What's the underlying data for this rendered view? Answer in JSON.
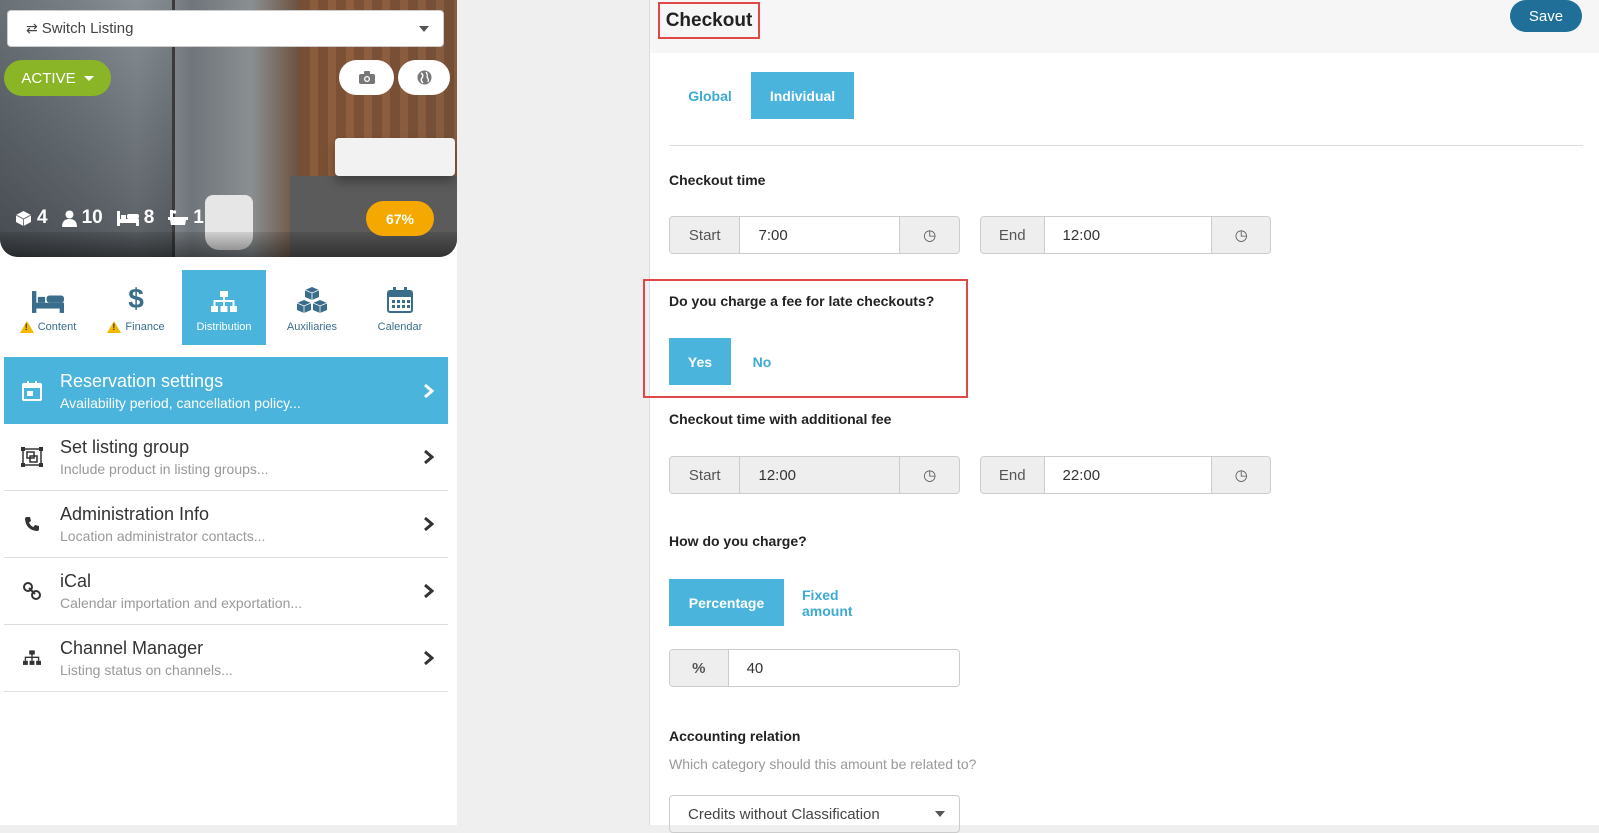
{
  "listing": {
    "switch_label": "Switch Listing",
    "status": "ACTIVE",
    "stats": {
      "rooms": "4",
      "guests": "10",
      "beds": "8",
      "baths": "1"
    },
    "completion": "67%"
  },
  "tabs": [
    {
      "label": "Content",
      "icon": "bed-icon",
      "warning": true
    },
    {
      "label": "Finance",
      "icon": "dollar-icon",
      "warning": true
    },
    {
      "label": "Distribution",
      "icon": "sitemap-icon",
      "active": true
    },
    {
      "label": "Auxiliaries",
      "icon": "cubes-icon"
    },
    {
      "label": "Calendar",
      "icon": "calendar-icon"
    }
  ],
  "menu": [
    {
      "title": "Reservation settings",
      "subtitle": "Availability period, cancellation policy...",
      "icon": "calendar-check-icon",
      "active": true
    },
    {
      "title": "Set listing group",
      "subtitle": "Include product in listing groups...",
      "icon": "object-group-icon"
    },
    {
      "title": "Administration Info",
      "subtitle": "Location administrator contacts...",
      "icon": "phone-icon"
    },
    {
      "title": "iCal",
      "subtitle": "Calendar importation and exportation...",
      "icon": "link-icon"
    },
    {
      "title": "Channel Manager",
      "subtitle": "Listing status on channels...",
      "icon": "sitemap-icon"
    }
  ],
  "checkout": {
    "title": "Checkout",
    "save_label": "Save",
    "scope_tabs": {
      "global": "Global",
      "individual": "Individual",
      "selected": "Individual"
    },
    "checkout_time": {
      "label": "Checkout time",
      "start_label": "Start",
      "start_value": "7:00",
      "end_label": "End",
      "end_value": "12:00"
    },
    "late_fee": {
      "question": "Do you charge a fee for late checkouts?",
      "yes": "Yes",
      "no": "No",
      "selected": "Yes"
    },
    "fee_time": {
      "label": "Checkout time with additional fee",
      "start_label": "Start",
      "start_value": "12:00",
      "end_label": "End",
      "end_value": "22:00"
    },
    "charge_type": {
      "label": "How do you charge?",
      "percentage": "Percentage",
      "fixed": "Fixed amount",
      "selected": "Percentage"
    },
    "percent": {
      "symbol": "%",
      "value": "40"
    },
    "accounting": {
      "label": "Accounting relation",
      "help": "Which category should this amount be related to?",
      "selected": "Credits without Classification"
    }
  },
  "colors": {
    "accent": "#4ab4dc",
    "active_green": "#8ab526",
    "save_blue": "#1f6f98",
    "badge": "#f5a800",
    "highlight_red": "#e04848"
  }
}
